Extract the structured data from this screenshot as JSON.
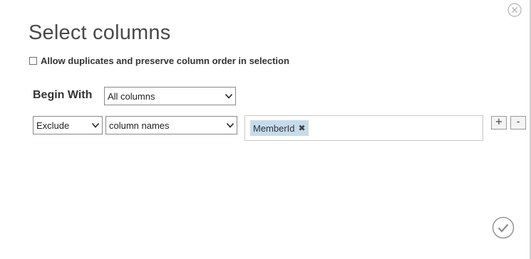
{
  "dialog": {
    "title": "Select columns",
    "close_icon": "close-circle-icon",
    "confirm_icon": "checkmark-circle-icon"
  },
  "options": {
    "allow_duplicates_label": "Allow duplicates and preserve column order in selection",
    "allow_duplicates_checked": false
  },
  "begin_with": {
    "label": "Begin With",
    "selected": "All columns"
  },
  "rule": {
    "mode_selected": "Exclude",
    "type_selected": "column names",
    "tags": [
      {
        "label": "MemberId",
        "remove_glyph": "✖"
      }
    ],
    "add_label": "+",
    "remove_label": "-"
  },
  "colors": {
    "tag_background": "#c5dceb",
    "icon_stroke": "#a0a0a0"
  }
}
